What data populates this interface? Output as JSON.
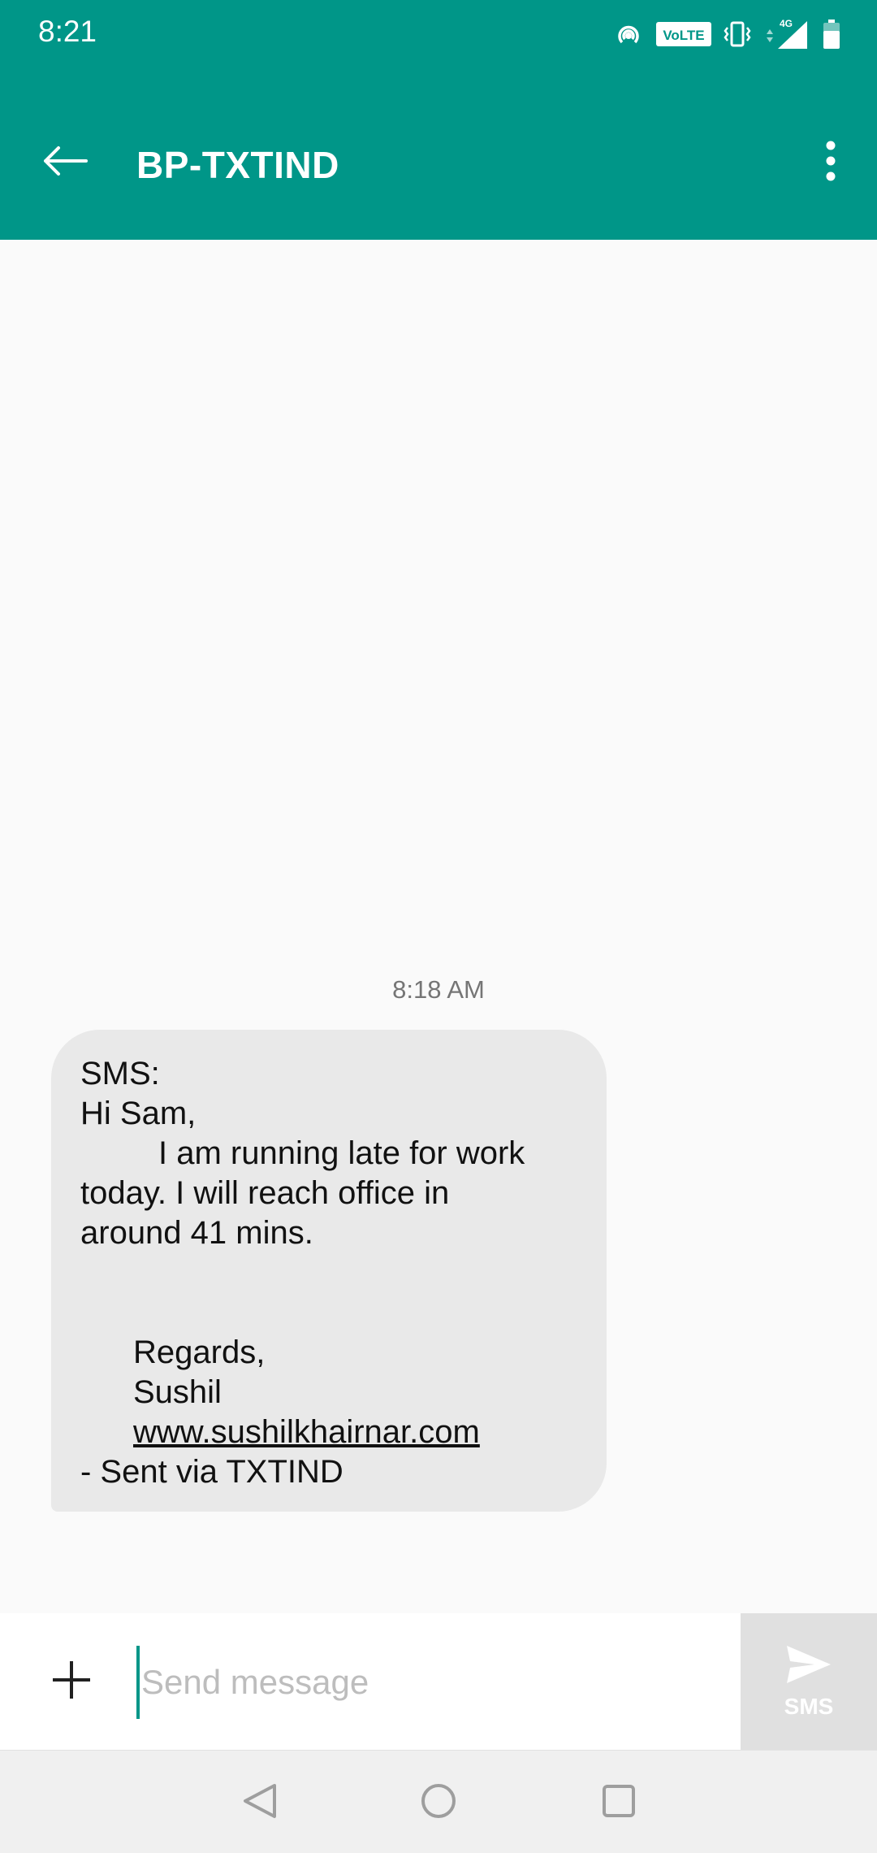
{
  "status_bar": {
    "time": "8:21",
    "icons": [
      "hotspot-icon",
      "volte-icon",
      "vibrate-icon",
      "signal-4g-icon",
      "battery-icon"
    ],
    "volte_label": "VoLTE",
    "network_label": "4G"
  },
  "app_bar": {
    "title": "BP-TXTIND",
    "back_icon": "arrow-left-icon",
    "menu_icon": "more-vert-icon",
    "color": "#009688"
  },
  "conversation": {
    "timestamp": "8:18 AM",
    "message": {
      "lines": {
        "l1": "SMS:",
        "l2": "Hi Sam,",
        "l3": "I am running late for work",
        "l4": "today. I will reach office in",
        "l5": "around 41 mins.",
        "l6": "Regards,",
        "l7": "Sushil",
        "l8": "www.sushilkhairnar.com",
        "l9": "- Sent via TXTIND"
      },
      "bubble_color": "#e9e9e9"
    }
  },
  "compose": {
    "placeholder": "Send message",
    "value": "",
    "add_icon": "plus-icon",
    "send_icon": "send-icon",
    "send_label": "SMS"
  },
  "nav_bar": {
    "icons": [
      "nav-back-icon",
      "nav-home-icon",
      "nav-recents-icon"
    ]
  }
}
